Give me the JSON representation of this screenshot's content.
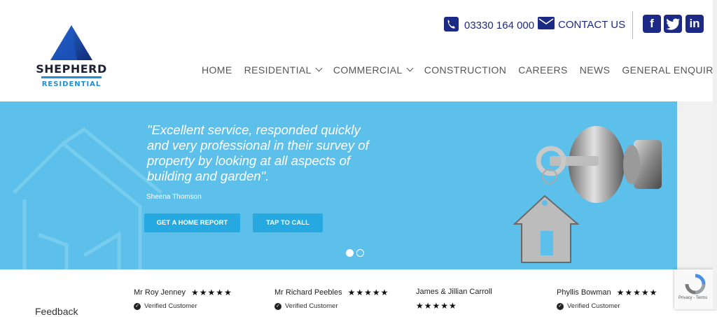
{
  "header": {
    "logo": {
      "name": "SHEPHERD",
      "sub": "RESIDENTIAL"
    },
    "phone": "03330 164 000",
    "contact": "CONTACT US",
    "social": [
      {
        "name": "facebook-icon",
        "glyph": "f"
      },
      {
        "name": "twitter-icon",
        "glyph": "t"
      },
      {
        "name": "linkedin-icon",
        "glyph": "in"
      }
    ]
  },
  "nav": [
    {
      "label": "HOME",
      "dropdown": false
    },
    {
      "label": "RESIDENTIAL",
      "dropdown": true
    },
    {
      "label": "COMMERCIAL",
      "dropdown": true
    },
    {
      "label": "CONSTRUCTION",
      "dropdown": false
    },
    {
      "label": "CAREERS",
      "dropdown": false
    },
    {
      "label": "NEWS",
      "dropdown": false
    },
    {
      "label": "GENERAL ENQUIRIES",
      "dropdown": true
    }
  ],
  "hero": {
    "quote": "\"Excellent service, responded quickly and very professional in their survey of property by looking at all aspects of building and garden\".",
    "author": "Sheena Thomson",
    "btn_report": "GET A HOME REPORT",
    "btn_call": "TAP TO CALL",
    "slides": {
      "active": 1,
      "count": 2
    }
  },
  "reviews": {
    "heading": "Feedback",
    "items": [
      {
        "name": "Mr Roy Jenney",
        "stars": "★★★★★",
        "verified": "Verified Customer"
      },
      {
        "name": "Mr Richard Peebles",
        "stars": "★★★★★",
        "verified": "Verified Customer"
      },
      {
        "name": "James & Jillian Carroll",
        "stars": "★★★★★",
        "verified": ""
      },
      {
        "name": "Phyllis Bowman",
        "stars": "★★★★★",
        "verified": "Verified Customer"
      }
    ]
  },
  "recaptcha": {
    "text": "Privacy - Terms"
  },
  "colors": {
    "brand": "#1c2a86",
    "accent": "#1f8fd6",
    "hero": "#5cc0ea",
    "button": "#25a9e0"
  }
}
